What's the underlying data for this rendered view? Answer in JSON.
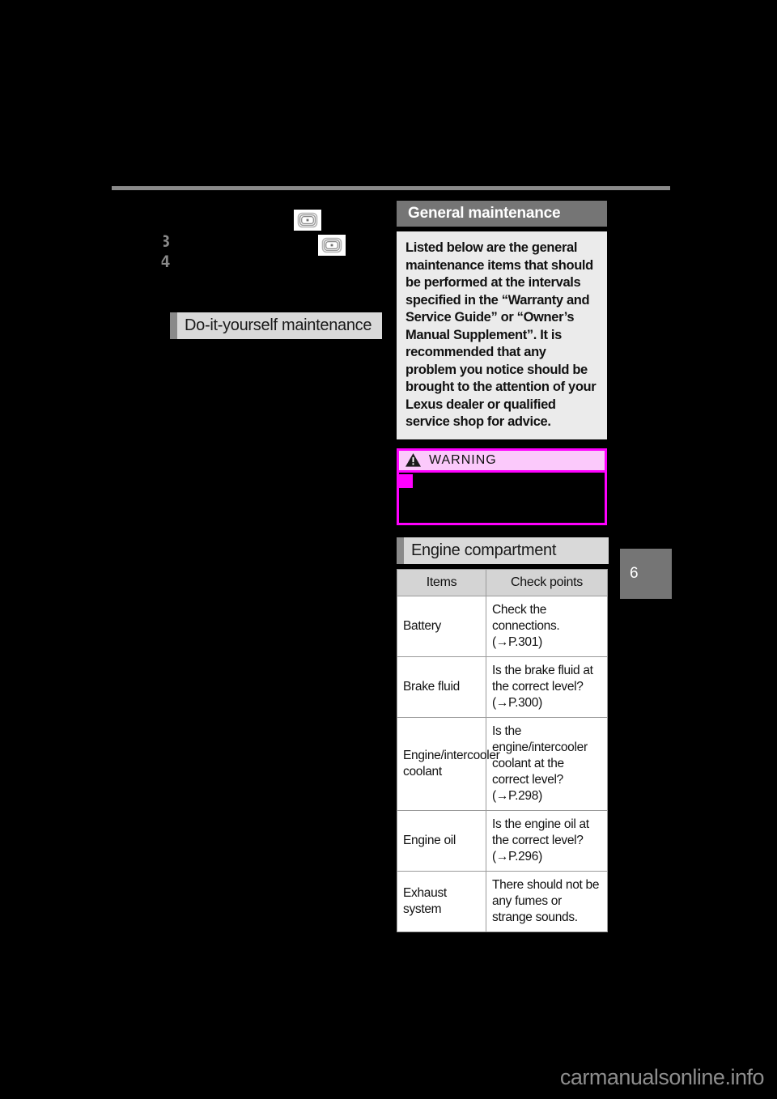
{
  "page": {
    "background_color": "#000000",
    "page_tab_number": "6",
    "watermark": "carmanualsonline.info"
  },
  "left_column": {
    "step_numbers": [
      "3",
      "4"
    ],
    "inline_icons": [
      {
        "name": "vehicle-display-icon"
      },
      {
        "name": "vehicle-display-icon"
      }
    ],
    "diy_heading": "Do-it-yourself maintenance"
  },
  "right_column": {
    "section_title": "General maintenance",
    "intro_paragraph": "Listed below are the general maintenance items that should be performed at the intervals specified in the “Warranty and Service Guide” or “Owner’s Manual Supplement”. It is recommended that any problem you notice should be brought to the attention of your Lexus dealer or qualified service shop for advice.",
    "warning": {
      "label": "WARNING",
      "header_color": "#fbc9fb",
      "border_color": "#ff00ff",
      "body_text": ""
    },
    "engine_heading": "Engine compartment",
    "table": {
      "columns": [
        "Items",
        "Check points"
      ],
      "rows": [
        {
          "item": "Battery",
          "check": "Check the connections. (→P.301)"
        },
        {
          "item": "Brake fluid",
          "check": "Is the brake fluid at the correct level? (→P.300)"
        },
        {
          "item": "Engine/intercooler coolant",
          "check": "Is the engine/intercooler coolant at the correct level? (→P.298)"
        },
        {
          "item": "Engine oil",
          "check": "Is the engine oil at the correct level? (→P.296)"
        },
        {
          "item": "Exhaust system",
          "check": "There should not be any fumes or strange sounds."
        }
      ]
    }
  },
  "colors": {
    "heading_gray": "#757575",
    "bar_gray": "#d9d9d9",
    "accent_gray": "#8a8a8a",
    "intro_bg": "#ebebeb",
    "table_header_bg": "#d4d4d4",
    "warning_magenta": "#ff00ff"
  }
}
